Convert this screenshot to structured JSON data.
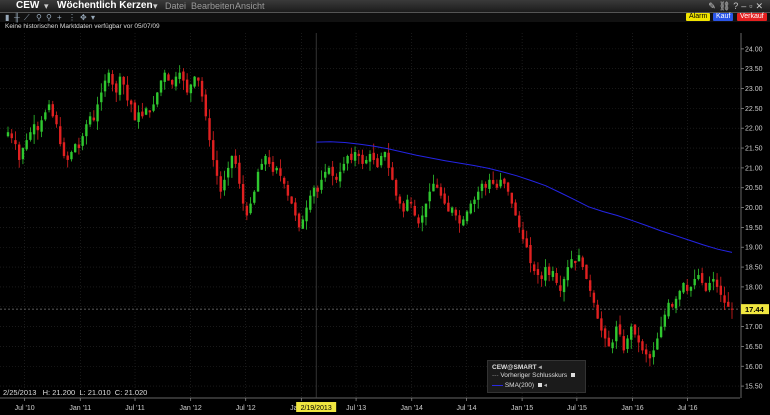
{
  "window": {
    "symbol": "CEW",
    "symbol_caret": "▾",
    "chart_title": "Wöchentlich Kerzen",
    "title_caret": "▾",
    "menu": [
      "Datei",
      "Bearbeiten",
      "Ansicht"
    ]
  },
  "order_buttons": {
    "alarm": "Alarm",
    "buy": "Kauf",
    "sell": "Verkauf"
  },
  "info_message": "Keine historischen Marktdaten verfügbar vor 05/07/09",
  "crosshair": {
    "date": "2/25/2013",
    "h": "21.200",
    "l": "21.010",
    "c": "21.020",
    "x_label": "2/19/2013"
  },
  "last_price": "17.44",
  "legend": {
    "title": "CEW@SMART",
    "items": [
      {
        "label": "Vorheriger Schlusskurs",
        "color": "#8a8a8a"
      },
      {
        "label": "SMA(200)",
        "color": "#2a2ae0"
      }
    ]
  },
  "colors": {
    "up": "#2fc72f",
    "down": "#e02020",
    "sma": "#2424e6",
    "grid": "#2a2a2a",
    "axis_text": "#cfcfcf",
    "last_price_bg": "#f0e640"
  },
  "chart_data": {
    "type": "candlestick",
    "title": "Wöchentlich Kerzen",
    "ylim": [
      15.2,
      24.4
    ],
    "y_ticks": [
      "15.50",
      "16.00",
      "16.50",
      "17.00",
      "17.50",
      "18.00",
      "18.50",
      "19.00",
      "19.50",
      "20.00",
      "20.50",
      "21.00",
      "21.50",
      "22.00",
      "22.50",
      "23.00",
      "23.50",
      "24.00"
    ],
    "x_ticks": [
      "Jul '10",
      "Jan '11",
      "Jul '11",
      "Jan '12",
      "Jul '12",
      "Jan '13",
      "Jul '13",
      "Jan '14",
      "Jul '14",
      "Jan '15",
      "Jul '15",
      "Jan '16",
      "Jul '16"
    ],
    "close_path": {
      "dates": [
        "2010-05-07",
        "2010-06-01",
        "2010-07-01",
        "2010-08-01",
        "2010-09-01",
        "2010-10-01",
        "2010-11-01",
        "2010-12-01",
        "2011-01-01",
        "2011-02-01",
        "2011-03-01",
        "2011-04-01",
        "2011-05-01",
        "2011-06-01",
        "2011-07-01",
        "2011-08-01",
        "2011-09-01",
        "2011-10-01",
        "2011-11-01",
        "2011-12-01",
        "2012-01-01",
        "2012-02-01",
        "2012-03-01",
        "2012-04-01",
        "2012-05-01",
        "2012-06-01",
        "2012-07-01",
        "2012-08-01",
        "2012-09-01",
        "2012-10-01",
        "2012-11-01",
        "2012-12-01",
        "2013-01-01",
        "2013-02-01",
        "2013-03-01",
        "2013-04-01",
        "2013-05-01",
        "2013-06-01",
        "2013-07-01",
        "2013-08-01",
        "2013-09-01",
        "2013-10-01",
        "2013-11-01",
        "2013-12-01",
        "2014-01-01",
        "2014-02-01",
        "2014-03-01",
        "2014-04-01",
        "2014-05-01",
        "2014-06-01",
        "2014-07-01",
        "2014-08-01",
        "2014-09-01",
        "2014-10-01",
        "2014-11-01",
        "2014-12-01",
        "2015-01-01",
        "2015-02-01",
        "2015-03-01",
        "2015-04-01",
        "2015-05-01",
        "2015-06-01",
        "2015-07-01",
        "2015-08-01",
        "2015-09-01",
        "2015-10-01",
        "2015-11-01",
        "2015-12-01",
        "2016-01-01",
        "2016-02-01",
        "2016-03-01",
        "2016-04-01",
        "2016-05-01",
        "2016-06-01",
        "2016-07-01",
        "2016-08-01",
        "2016-09-01",
        "2016-10-01",
        "2016-11-01"
      ],
      "values": [
        21.9,
        21.7,
        22.3,
        22.4,
        21.5,
        21.3,
        21.6,
        22.9,
        23.3,
        23.0,
        22.3,
        22.5,
        23.4,
        23.2,
        23.2,
        22.0,
        20.7,
        21.0,
        20.0,
        20.8,
        21.2,
        21.1,
        20.8,
        20.3,
        19.6,
        20.4,
        20.7,
        21.0,
        21.2,
        21.3,
        21.4,
        21.2,
        21.4,
        21.1,
        21.0,
        20.1,
        19.9,
        19.6,
        20.5,
        20.2,
        19.9,
        19.7,
        19.8,
        20.0,
        20.4,
        20.5,
        20.7,
        20.6,
        20.2,
        19.6,
        19.0,
        18.5,
        18.2,
        18.3,
        18.7,
        17.8,
        17.0,
        16.5,
        16.9,
        16.5,
        16.3,
        17.3,
        17.5,
        17.9,
        18.0,
        18.2,
        18.1,
        17.6,
        17.44,
        17.5,
        17.6,
        17.4,
        17.2,
        17.3,
        17.4,
        17.5,
        17.6,
        17.7,
        17.44
      ],
      "note": "unused"
    },
    "closes": {
      "start": "2010-05-07",
      "interval_days": 7,
      "values": [
        21.9,
        21.75,
        21.6,
        21.2,
        21.5,
        21.7,
        21.9,
        22.1,
        21.95,
        22.2,
        22.4,
        22.6,
        22.3,
        22.1,
        21.6,
        21.3,
        21.2,
        21.4,
        21.6,
        21.5,
        21.8,
        22.1,
        22.3,
        22.2,
        22.6,
        22.9,
        23.2,
        23.4,
        23.1,
        22.9,
        23.3,
        23.1,
        22.7,
        22.6,
        22.2,
        22.4,
        22.3,
        22.5,
        22.4,
        22.6,
        22.9,
        23.2,
        23.4,
        23.2,
        23.1,
        23.3,
        23.4,
        23.2,
        22.9,
        23.1,
        23.3,
        23.2,
        22.8,
        22.3,
        21.7,
        21.2,
        20.8,
        20.4,
        20.7,
        21.0,
        21.3,
        21.1,
        20.6,
        20.1,
        19.8,
        20.1,
        20.4,
        20.9,
        21.1,
        21.3,
        21.1,
        20.9,
        21.0,
        20.8,
        20.6,
        20.3,
        20.1,
        19.8,
        19.5,
        19.7,
        20.0,
        20.3,
        20.5,
        20.4,
        20.7,
        20.9,
        21.0,
        20.8,
        20.7,
        20.9,
        21.1,
        21.3,
        21.2,
        21.4,
        21.3,
        21.1,
        21.2,
        21.35,
        21.2,
        21.02,
        21.3,
        21.4,
        21.0,
        20.7,
        20.3,
        20.1,
        19.9,
        20.2,
        20.1,
        19.8,
        19.6,
        19.8,
        20.1,
        20.4,
        20.6,
        20.5,
        20.3,
        20.1,
        19.9,
        20.0,
        19.8,
        19.6,
        19.7,
        19.9,
        20.1,
        20.2,
        20.4,
        20.6,
        20.5,
        20.7,
        20.6,
        20.5,
        20.7,
        20.6,
        20.4,
        20.1,
        19.8,
        19.5,
        19.2,
        19.0,
        18.6,
        18.4,
        18.3,
        18.2,
        18.5,
        18.3,
        18.4,
        18.1,
        17.9,
        18.2,
        18.5,
        18.7,
        18.6,
        18.8,
        18.5,
        18.2,
        17.9,
        17.6,
        17.2,
        16.9,
        16.7,
        16.5,
        16.6,
        17.0,
        16.8,
        16.4,
        16.7,
        17.0,
        16.8,
        16.6,
        16.4,
        16.3,
        16.2,
        16.4,
        16.7,
        17.0,
        17.3,
        17.6,
        17.5,
        17.7,
        17.9,
        18.1,
        17.9,
        18.0,
        18.2,
        18.3,
        18.1,
        17.9,
        18.1,
        18.2,
        18.0,
        17.8,
        17.6,
        17.5,
        17.44
      ]
    },
    "sma200": {
      "start": "2013-02-19",
      "end": "2016-11-25",
      "values": [
        21.65,
        21.66,
        21.64,
        21.6,
        21.55,
        21.48,
        21.4,
        21.32,
        21.25,
        21.18,
        21.12,
        21.06,
        20.99,
        20.9,
        20.8,
        20.68,
        20.55,
        20.38,
        20.2,
        20.02,
        19.9,
        19.8,
        19.68,
        19.55,
        19.42,
        19.3,
        19.18,
        19.06,
        18.95,
        18.87
      ]
    },
    "last_close": 17.44
  }
}
